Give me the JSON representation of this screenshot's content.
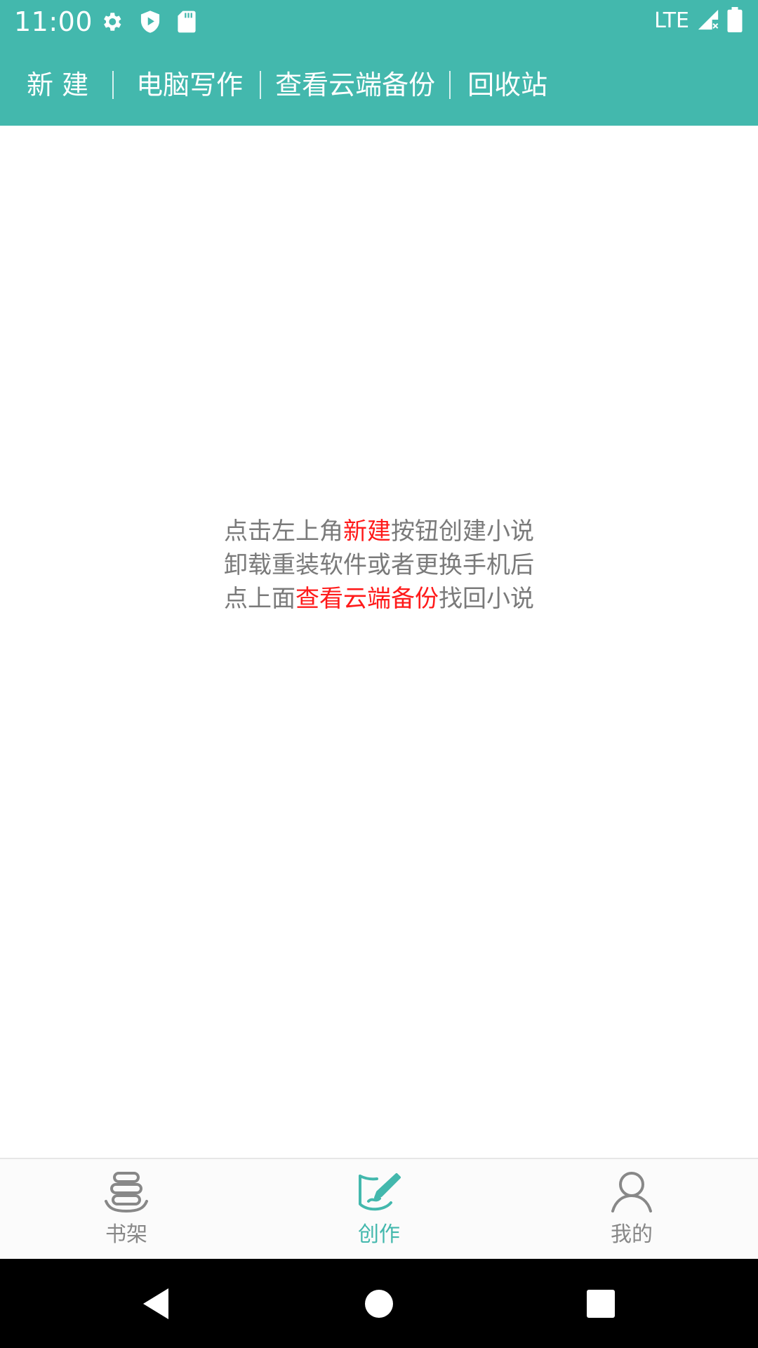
{
  "status_bar": {
    "time": "11:00",
    "network": "LTE",
    "icons": [
      "gear-icon",
      "shield-play-icon",
      "sd-card-icon",
      "signal-icon",
      "battery-icon"
    ]
  },
  "toolbar": {
    "new_label": "新 建",
    "pc_write_label": "电脑写作",
    "cloud_backup_label": "查看云端备份",
    "recycle_label": "回收站"
  },
  "hint": {
    "line1_pre": "点击左上角",
    "line1_hl": "新建",
    "line1_post": "按钮创建小说",
    "line2": "卸载重装软件或者更换手机后",
    "line3_pre": "点上面",
    "line3_hl": "查看云端备份",
    "line3_post": "找回小说"
  },
  "bottom_nav": {
    "items": [
      {
        "label": "书架",
        "icon": "bookshelf-icon",
        "active": false
      },
      {
        "label": "创作",
        "icon": "pen-write-icon",
        "active": true
      },
      {
        "label": "我的",
        "icon": "user-icon",
        "active": false
      }
    ]
  },
  "colors": {
    "primary": "#43b8ad",
    "highlight": "#ff1a1a",
    "text_gray": "#7a7a7a",
    "nav_inactive": "#888888"
  }
}
